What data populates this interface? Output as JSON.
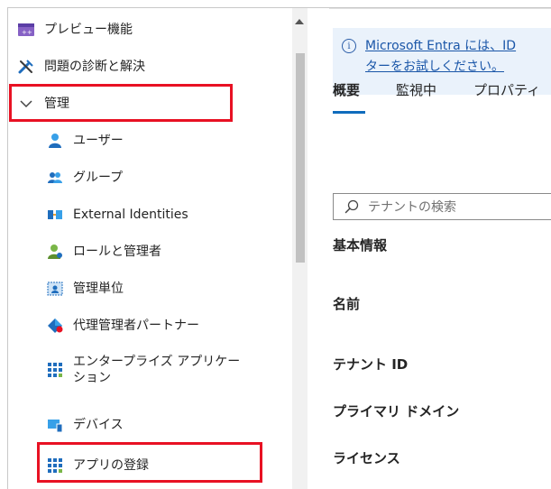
{
  "sidebar": {
    "items": [
      {
        "label": "プレビュー機能",
        "icon": "preview-icon"
      },
      {
        "label": "問題の診断と解決",
        "icon": "wrench-icon"
      },
      {
        "label": "管理",
        "icon": "chevron-down-icon"
      },
      {
        "label": "ユーザー",
        "icon": "user-icon"
      },
      {
        "label": "グループ",
        "icon": "group-icon"
      },
      {
        "label": "External Identities",
        "icon": "external-identities-icon"
      },
      {
        "label": "ロールと管理者",
        "icon": "roles-icon"
      },
      {
        "label": "管理単位",
        "icon": "admin-unit-icon"
      },
      {
        "label": "代理管理者パートナー",
        "icon": "partner-icon"
      },
      {
        "label": "エンタープライズ アプリケー",
        "label2": "ション",
        "icon": "enterprise-apps-icon"
      },
      {
        "label": "デバイス",
        "icon": "devices-icon"
      },
      {
        "label": "アプリの登録",
        "icon": "app-registrations-icon"
      }
    ]
  },
  "main": {
    "banner": {
      "line1": "Microsoft Entra には、ID",
      "line2": "ターをお試しください。"
    },
    "tabs": [
      "概要",
      "監視中",
      "プロパティ"
    ],
    "search_placeholder": "テナントの検索",
    "fields": [
      "基本情報",
      "名前",
      "テナント ID",
      "プライマリ ドメイン",
      "ライセンス"
    ]
  },
  "colors": {
    "highlight": "#e81123",
    "accent": "#0f6cbd",
    "banner_bg": "#eaf2fb"
  }
}
